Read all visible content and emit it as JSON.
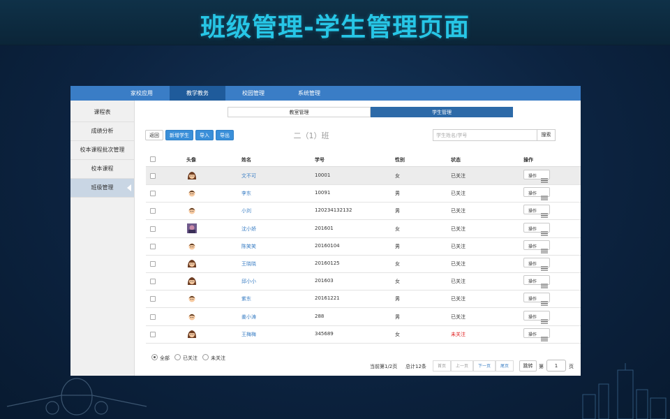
{
  "banner": {
    "title": "班级管理-学生管理页面"
  },
  "topnav": {
    "items": [
      {
        "label": "家校应用"
      },
      {
        "label": "教学教务",
        "active": true
      },
      {
        "label": "校园管理"
      },
      {
        "label": "系统管理"
      }
    ]
  },
  "sidebar": {
    "items": [
      {
        "label": "课程表"
      },
      {
        "label": "成绩分析"
      },
      {
        "label": "校本课程批次管理"
      },
      {
        "label": "校本课程"
      },
      {
        "label": "班级管理",
        "active": true
      }
    ]
  },
  "subtabs": {
    "classroom": "教室管理",
    "students": "学生管理",
    "active": "students"
  },
  "toolbar": {
    "back": "返回",
    "add_student": "新增学生",
    "import": "导入",
    "export": "导出",
    "class_title": "二（1）班",
    "search_placeholder": "学生姓名/学号",
    "search_button": "搜索"
  },
  "table": {
    "headers": [
      "头像",
      "姓名",
      "学号",
      "性别",
      "状态",
      "操作"
    ],
    "rows": [
      {
        "avatar": "girl-avatar-icon",
        "name": "文不可",
        "id": "10001",
        "gender": "女",
        "status": "已关注",
        "action": "操作"
      },
      {
        "avatar": "boy-avatar-icon",
        "name": "李东",
        "id": "10091",
        "gender": "男",
        "status": "已关注",
        "action": "操作"
      },
      {
        "avatar": "boy-avatar-icon",
        "name": "小刘",
        "id": "120234132132",
        "gender": "男",
        "status": "已关注",
        "action": "操作"
      },
      {
        "avatar": "photo-avatar-icon",
        "name": "沈小娇",
        "id": "201601",
        "gender": "女",
        "status": "已关注",
        "action": "操作"
      },
      {
        "avatar": "boy-avatar-icon",
        "name": "陈笑笑",
        "id": "20160104",
        "gender": "男",
        "status": "已关注",
        "action": "操作"
      },
      {
        "avatar": "girl-avatar-icon",
        "name": "王晓晓",
        "id": "20160125",
        "gender": "女",
        "status": "已关注",
        "action": "操作"
      },
      {
        "avatar": "girl-avatar-icon",
        "name": "邱小小",
        "id": "201603",
        "gender": "女",
        "status": "已关注",
        "action": "操作"
      },
      {
        "avatar": "boy-avatar-icon",
        "name": "紫东",
        "id": "20161221",
        "gender": "男",
        "status": "已关注",
        "action": "操作"
      },
      {
        "avatar": "boy-avatar-icon",
        "name": "姜小涛",
        "id": "288",
        "gender": "男",
        "status": "已关注",
        "action": "操作"
      },
      {
        "avatar": "girl-avatar-icon",
        "name": "王梅梅",
        "id": "345689",
        "gender": "女",
        "status": "未关注",
        "action": "操作"
      }
    ]
  },
  "filters": {
    "all": "全部",
    "followed": "已关注",
    "unfollowed": "未关注",
    "selected": "all"
  },
  "pagination": {
    "current_text": "当前第1/2页",
    "total_text": "总计12条",
    "first": "首页",
    "prev": "上一页",
    "next": "下一页",
    "last": "尾页",
    "jump": "跳转",
    "page_prefix": "第",
    "page_value": "1",
    "page_suffix": "页"
  },
  "colors": {
    "nav_blue": "#3a7dc6",
    "nav_active": "#1f5b9b",
    "button_blue": "#3a8fd9",
    "link_blue": "#3a7ec4",
    "unfollowed_red": "#e02020",
    "banner_title": "#27c6e6"
  }
}
